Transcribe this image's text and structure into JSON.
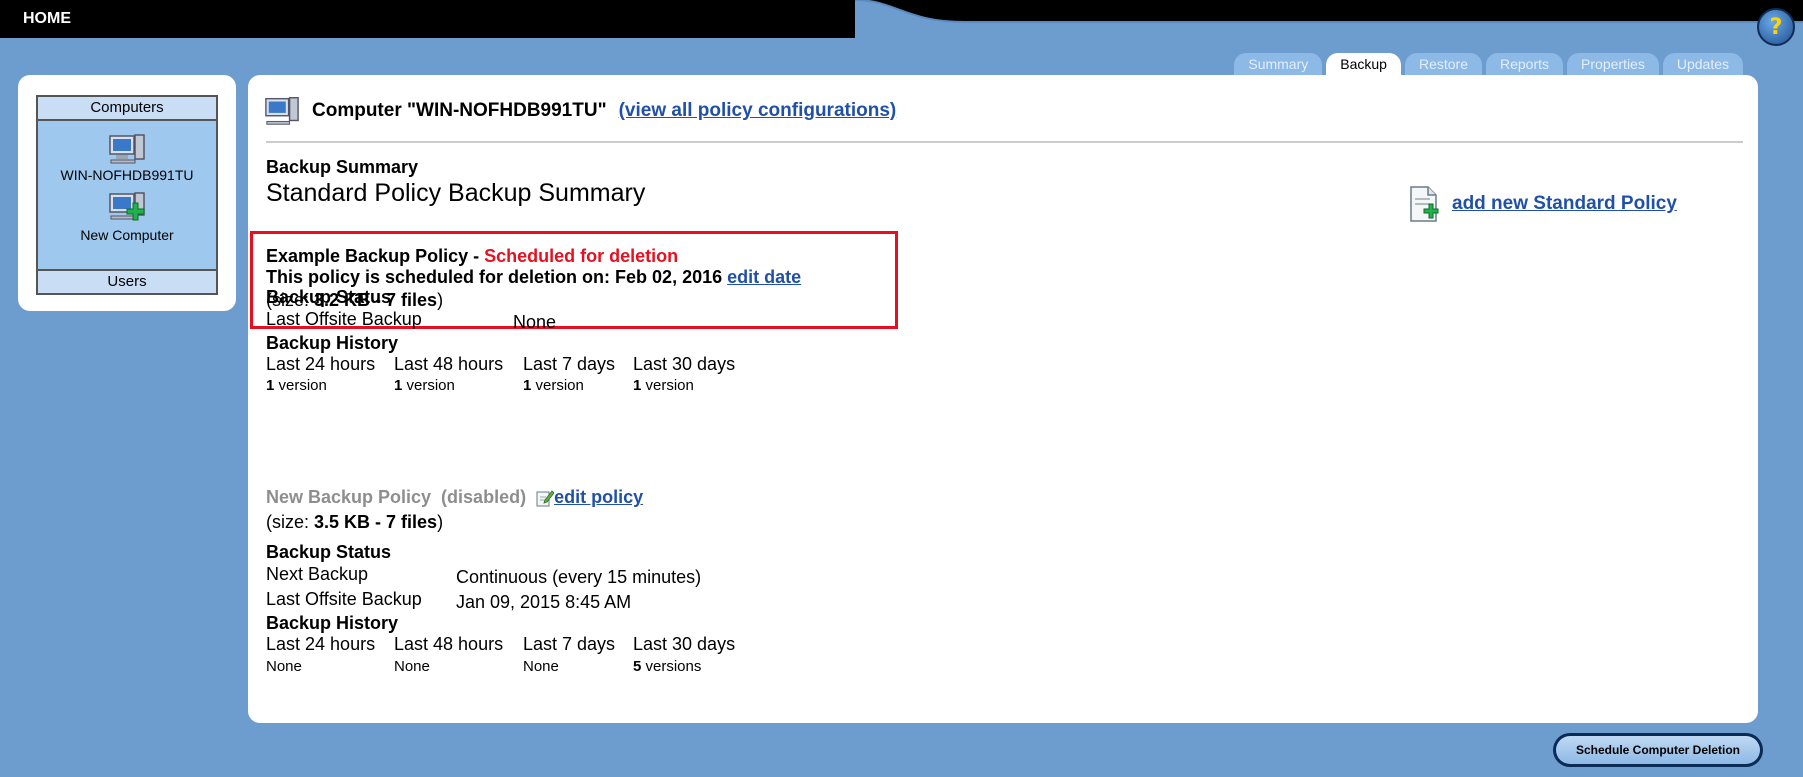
{
  "header": {
    "home_label": "HOME",
    "help_label": "?"
  },
  "tabs": [
    {
      "label": "Summary",
      "active": false
    },
    {
      "label": "Backup",
      "active": true
    },
    {
      "label": "Restore",
      "active": false
    },
    {
      "label": "Reports",
      "active": false
    },
    {
      "label": "Properties",
      "active": false
    },
    {
      "label": "Updates",
      "active": false
    }
  ],
  "sidebar": {
    "header": "Computers",
    "computer_label": "WIN-NOFHDB991TU",
    "new_computer_label": "New Computer",
    "footer": "Users"
  },
  "main": {
    "computer_title": "Computer \"WIN-NOFHDB991TU\"",
    "view_all_link": "(view all policy configurations)",
    "backup_summary": "Backup Summary",
    "standard_title": "Standard Policy Backup Summary",
    "add_policy_link": "add new Standard Policy",
    "policy1": {
      "name": "Example Backup Policy - ",
      "status": "Scheduled for deletion",
      "deletion_text": "This policy is scheduled for deletion on: Feb 02, 2016",
      "edit_date_link": "edit date",
      "size_prefix": "(size: ",
      "size_value": "3.2 KB - 7 files",
      "size_suffix": ")",
      "status_title": "Backup Status",
      "last_offsite_label": "Last Offsite Backup",
      "last_offsite_value": "None",
      "history_title": "Backup History",
      "history": [
        {
          "label": "Last 24 hours",
          "count": "1",
          "unit": " version"
        },
        {
          "label": "Last 48 hours",
          "count": "1",
          "unit": " version"
        },
        {
          "label": "Last 7 days",
          "count": "1",
          "unit": " version"
        },
        {
          "label": "Last 30 days",
          "count": "1",
          "unit": " version"
        }
      ]
    },
    "policy2": {
      "name": "New Backup Policy  (disabled)",
      "edit_link": "edit policy",
      "size_prefix": "(size: ",
      "size_value": "3.5 KB - 7 files",
      "size_suffix": ")",
      "status_title": "Backup Status",
      "next_backup_label": "Next Backup",
      "next_backup_value": "Continuous (every 15 minutes)",
      "last_offsite_label": "Last Offsite Backup",
      "last_offsite_value": "Jan 09, 2015 8:45 AM",
      "history_title": "Backup History",
      "history": [
        {
          "label": "Last 24 hours",
          "count": "",
          "unit": "None"
        },
        {
          "label": "Last 48 hours",
          "count": "",
          "unit": "None"
        },
        {
          "label": "Last 7 days",
          "count": "",
          "unit": "None"
        },
        {
          "label": "Last 30 days",
          "count": "5",
          "unit": " versions"
        }
      ]
    }
  },
  "actions": {
    "schedule_deletion": "Schedule Computer Deletion"
  },
  "colors": {
    "background": "#6d9cce",
    "link": "#2150a8",
    "alert": "#e81020",
    "disabled": "#8e8e8e"
  }
}
